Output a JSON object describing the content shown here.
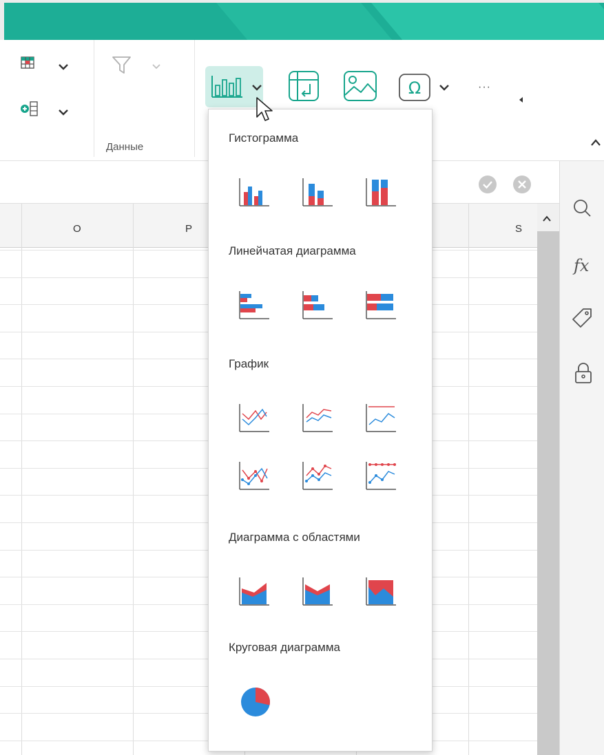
{
  "colors": {
    "accent": "#1dae96",
    "chart_red": "#e0454c",
    "chart_blue": "#2b8bdc",
    "icon_teal": "#17a58c"
  },
  "ribbon": {
    "data_group_label": "Данные",
    "more_label": "···"
  },
  "columns": [
    "O",
    "P",
    "S"
  ],
  "chart_menu": {
    "sections": [
      {
        "title": "Гистограмма",
        "items": [
          "clustered-column-icon",
          "stacked-column-icon",
          "stacked-100-column-icon"
        ]
      },
      {
        "title": "Линейчатая диаграмма",
        "items": [
          "clustered-bar-icon",
          "stacked-bar-icon",
          "stacked-100-bar-icon"
        ]
      },
      {
        "title": "График",
        "items": [
          "line-icon",
          "stacked-line-icon",
          "stacked-100-line-icon",
          "line-markers-icon",
          "stacked-line-markers-icon",
          "stacked-100-line-markers-icon"
        ]
      },
      {
        "title": "Диаграмма с областями",
        "items": [
          "area-icon",
          "stacked-area-icon",
          "stacked-100-area-icon"
        ]
      },
      {
        "title": "Круговая диаграмма",
        "items": [
          "pie-icon"
        ]
      }
    ]
  }
}
